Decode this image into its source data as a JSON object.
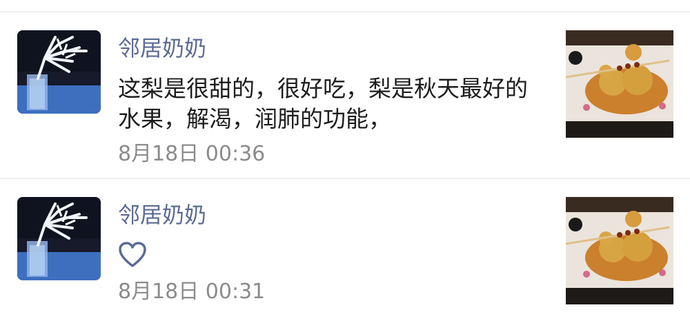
{
  "comments": [
    {
      "author": "邻居奶奶",
      "text": "这梨是很甜的，很好吃，梨是秋天最好的水果，解渴，润肺的功能，",
      "time": "8月18日 00:36"
    },
    {
      "author": "邻居奶奶",
      "reaction_icon": "heart-outline-icon",
      "time": "8月18日 00:31"
    }
  ],
  "colors": {
    "name": "#5b6b93",
    "text": "#1d1d1d",
    "time": "#8b8b8b",
    "divider": "#eeeeee"
  }
}
